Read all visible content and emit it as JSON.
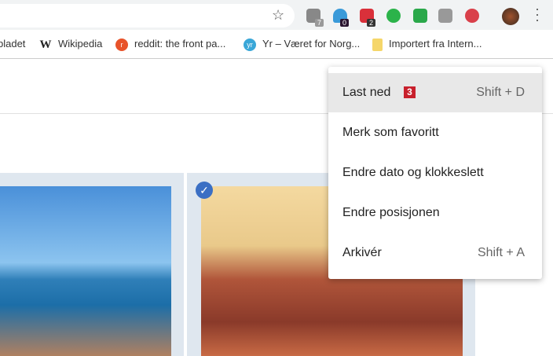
{
  "toolbar": {
    "extensions": [
      {
        "name": "gmail",
        "badge": "7",
        "color": "#888888"
      },
      {
        "name": "ghost",
        "badge": "0",
        "color": "#3a9ad9"
      },
      {
        "name": "chat",
        "badge": "2",
        "color": "#d9303a"
      },
      {
        "name": "whatsapp",
        "badge": "",
        "color": "#2bb34a"
      },
      {
        "name": "avast",
        "badge": "",
        "color": "#2aa84a"
      },
      {
        "name": "cast",
        "badge": "",
        "color": "#777777"
      },
      {
        "name": "alert",
        "badge": "",
        "color": "#d9404a"
      }
    ],
    "callout_2": "2"
  },
  "bookmarks": [
    {
      "label": "bladet",
      "icon": ""
    },
    {
      "label": "Wikipedia",
      "icon": "W"
    },
    {
      "label": "reddit: the front pa...",
      "icon": "r"
    },
    {
      "label": "Yr – Været for Norg...",
      "icon": "yr"
    },
    {
      "label": "Importert fra Intern...",
      "icon": ""
    }
  ],
  "menu": {
    "items": [
      {
        "label": "Last ned",
        "shortcut": "Shift + D",
        "callout": "3"
      },
      {
        "label": "Merk som favoritt",
        "shortcut": ""
      },
      {
        "label": "Endre dato og klokkeslett",
        "shortcut": ""
      },
      {
        "label": "Endre posisjonen",
        "shortcut": ""
      },
      {
        "label": "Arkivér",
        "shortcut": "Shift + A"
      }
    ]
  },
  "photos": {
    "check": "✓"
  }
}
